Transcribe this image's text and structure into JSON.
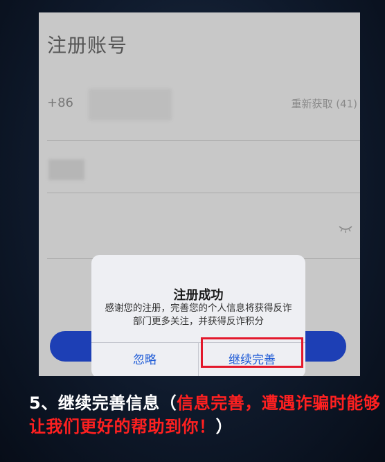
{
  "screen": {
    "title": "注册账号",
    "country_code": "+86",
    "resend_label": "重新获取 (41)"
  },
  "dialog": {
    "title": "注册成功",
    "message": "感谢您的注册，完善您的个人信息将获得反诈部门更多关注，并获得反诈积分",
    "ignore_label": "忽略",
    "continue_label": "继续完善"
  },
  "caption": {
    "white_part": "5、继续完善信息（",
    "red_part": "信息完善，遭遇诈骗时能够让我们更好的帮助到你！",
    "closing": "）"
  },
  "colors": {
    "accent_blue": "#1d3fb5",
    "dialog_button_blue": "#1d5ad6",
    "highlight_red": "#e3182b",
    "caption_red": "#ff2020"
  },
  "icons": {
    "password_toggle": "eye-closed-icon"
  }
}
